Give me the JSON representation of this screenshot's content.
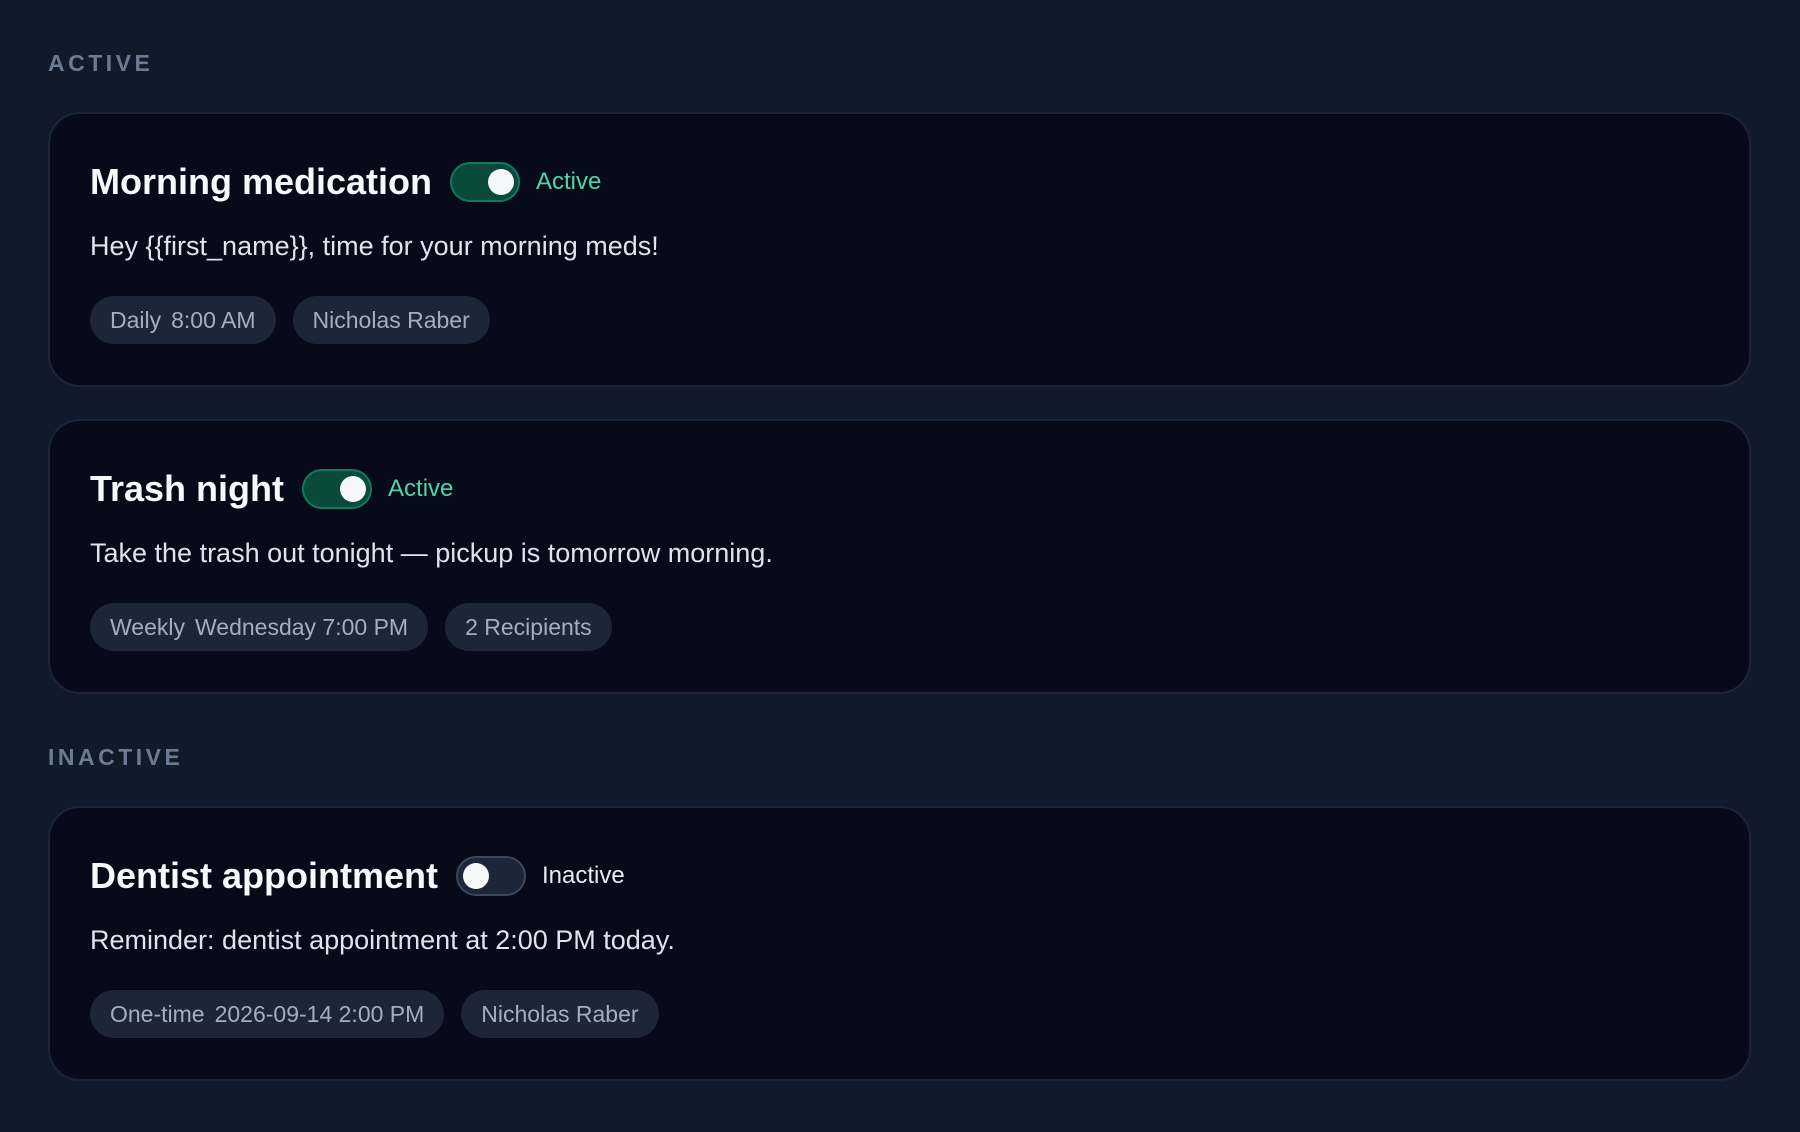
{
  "sections": {
    "active": {
      "label": "ACTIVE",
      "reminders": [
        {
          "title": "Morning medication",
          "enabled": true,
          "status": "Active",
          "message": "Hey {{first_name}}, time for your morning meds!",
          "schedule_type": "Daily",
          "schedule_time": "8:00 AM",
          "recipients": "Nicholas Raber"
        },
        {
          "title": "Trash night",
          "enabled": true,
          "status": "Active",
          "message": "Take the trash out tonight — pickup is tomorrow morning.",
          "schedule_type": "Weekly",
          "schedule_time": "Wednesday 7:00 PM",
          "recipients": "2 Recipients"
        }
      ]
    },
    "inactive": {
      "label": "INACTIVE",
      "reminders": [
        {
          "title": "Dentist appointment",
          "enabled": false,
          "status": "Inactive",
          "message": "Reminder: dentist appointment at 2:00 PM today.",
          "schedule_type": "One-time",
          "schedule_time": "2026-09-14 2:00 PM",
          "recipients": "Nicholas Raber"
        }
      ]
    }
  },
  "colors": {
    "page_background": "#111a2b",
    "card_background": "#060a19",
    "active_accent": "#4fd6a8",
    "chip_background": "#1d2637",
    "section_label": "#6b7b93"
  }
}
